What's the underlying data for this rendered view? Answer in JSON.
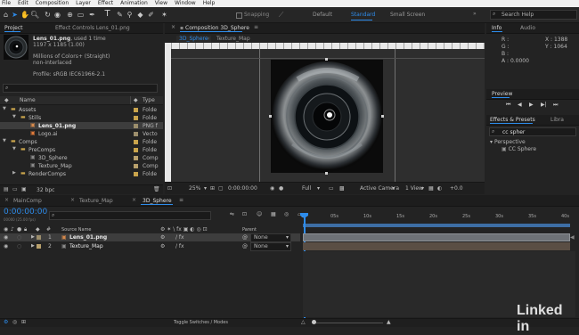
{
  "menu": [
    "File",
    "Edit",
    "Composition",
    "Layer",
    "Effect",
    "Animation",
    "View",
    "Window",
    "Help"
  ],
  "toolbar": {
    "snapping_label": "Snapping",
    "workspaces": [
      "Default",
      "Standard",
      "Small Screen"
    ],
    "active_workspace": "Standard",
    "search_placeholder": "Search Help"
  },
  "project": {
    "tab_label": "Project",
    "effect_controls_tab": "Effect Controls Lens_01.png",
    "file_name": "Lens_01.png",
    "used": ", used 1 time",
    "dimensions": "1197 x 1185 (1.00)",
    "colors": "Millions of Colors+ (Straight)",
    "interlace": "non-interlaced",
    "profile": "Profile: sRGB IEC61966-2.1",
    "col_name": "Name",
    "col_type": "Type",
    "bpc": "32 bpc",
    "items": [
      {
        "indent": 0,
        "arrow": "▼",
        "kind": "folder",
        "name": "Assets",
        "type": "Folde"
      },
      {
        "indent": 1,
        "arrow": "▼",
        "kind": "folder",
        "name": "Stills",
        "type": "Folde"
      },
      {
        "indent": 2,
        "arrow": "",
        "kind": "image",
        "name": "Lens_01.png",
        "type": "PNG f",
        "selected": true
      },
      {
        "indent": 2,
        "arrow": "",
        "kind": "ai",
        "name": "Logo.ai",
        "type": "Vecto"
      },
      {
        "indent": 0,
        "arrow": "▼",
        "kind": "folder",
        "name": "Comps",
        "type": "Folde"
      },
      {
        "indent": 1,
        "arrow": "▼",
        "kind": "folder",
        "name": "PreComps",
        "type": "Folde"
      },
      {
        "indent": 2,
        "arrow": "",
        "kind": "comp",
        "name": "3D_Sphere",
        "type": "Comp"
      },
      {
        "indent": 2,
        "arrow": "",
        "kind": "comp",
        "name": "Texture_Map",
        "type": "Comp"
      },
      {
        "indent": 1,
        "arrow": "▶",
        "kind": "folder",
        "name": "RenderComps",
        "type": "Folde"
      }
    ]
  },
  "composition": {
    "tab_label": "Composition 3D_Sphere",
    "subtabs": [
      "3D_Sphere",
      "Texture_Map"
    ],
    "zoom": "25%",
    "timecode": "0:00:00:00",
    "resolution": "Full",
    "camera": "Active Camera",
    "views": "1 View",
    "offset": "+0.0"
  },
  "info": {
    "tabs": [
      "Info",
      "Audio"
    ],
    "r": "R :",
    "g": "G :",
    "b": "B :",
    "a": "A : 0.0000",
    "x": "X : 1388",
    "y": "Y : 1064"
  },
  "preview": {
    "tab_label": "Preview"
  },
  "effects": {
    "tabs": [
      "Effects & Presets",
      "Libra"
    ],
    "search_value": "cc spher",
    "category": "Perspective",
    "effect": "CC Sphere"
  },
  "timeline": {
    "tabs": [
      "MainComp",
      "Texture_Map",
      "3D_Sphere"
    ],
    "active_tab": "3D_Sphere",
    "timecode": "0:00:00:00",
    "fps_info": "00000 (25.00 fps)",
    "col_source": "Source Name",
    "col_parent": "Parent",
    "ruler": [
      "0s",
      "05s",
      "10s",
      "15s",
      "20s",
      "25s",
      "30s",
      "35s",
      "40s"
    ],
    "layers": [
      {
        "num": "1",
        "name": "Lens_01.png",
        "parent": "None",
        "selected": true
      },
      {
        "num": "2",
        "name": "Texture_Map",
        "parent": "None",
        "selected": false
      }
    ],
    "toggle_label": "Toggle Switches / Modes"
  },
  "watermark": "Linked in"
}
